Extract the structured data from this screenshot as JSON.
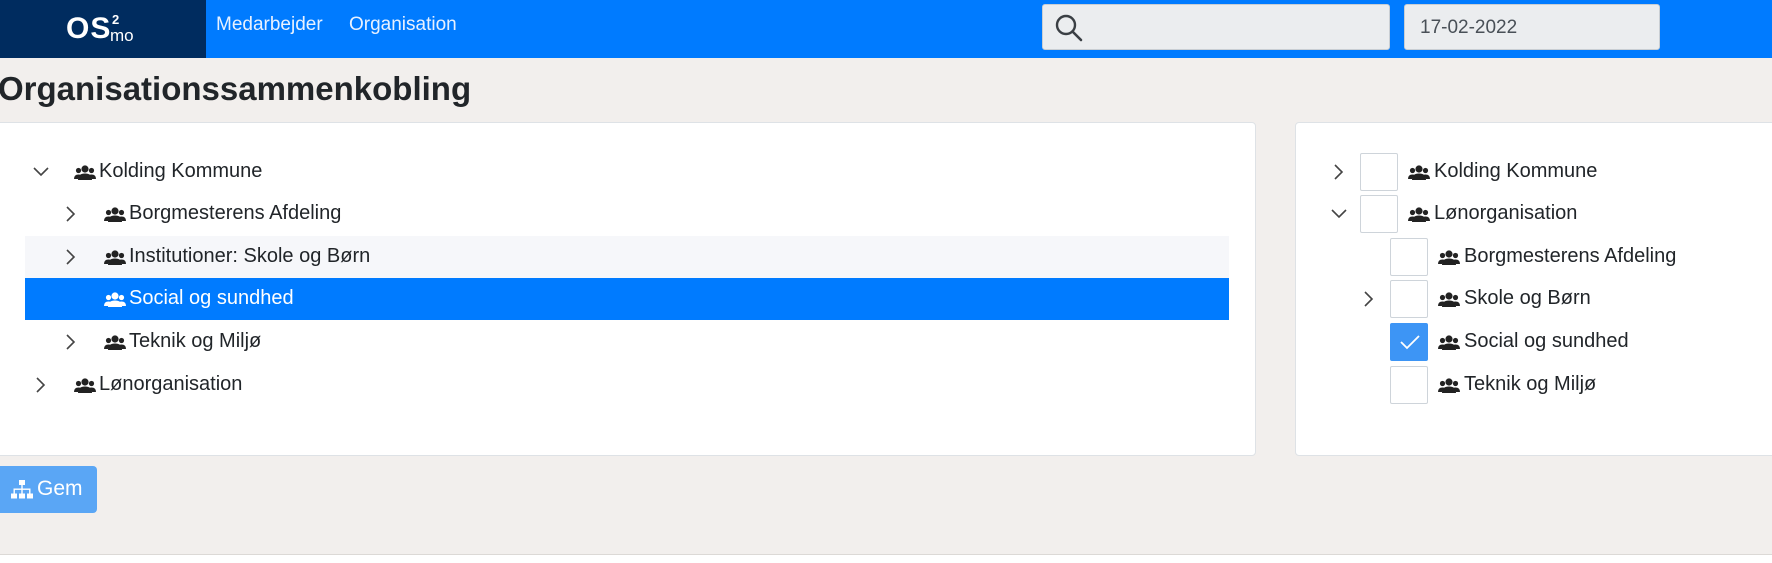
{
  "brand": {
    "logo_main": "OS",
    "logo_sup": "2",
    "logo_sub": "mo"
  },
  "nav": {
    "items": [
      {
        "label": "Medarbejder"
      },
      {
        "label": "Organisation"
      }
    ]
  },
  "search": {
    "value": "",
    "placeholder": ""
  },
  "date": {
    "value": "17-02-2022"
  },
  "page": {
    "title": "Organisationssammenkobling"
  },
  "left_tree": {
    "nodes": [
      {
        "label": "Kolding Kommune",
        "expander": "chevron-down",
        "level": 0
      },
      {
        "label": "Borgmesterens Afdeling",
        "expander": "chevron-right",
        "level": 1
      },
      {
        "label": "Institutioner: Skole og Børn",
        "expander": "chevron-right",
        "level": 1,
        "hovered": true
      },
      {
        "label": "Social og sundhed",
        "expander": "none",
        "level": 1,
        "selected": true
      },
      {
        "label": "Teknik og Miljø",
        "expander": "chevron-right",
        "level": 1
      },
      {
        "label": "Lønorganisation",
        "expander": "chevron-right",
        "level": 0
      }
    ]
  },
  "right_tree": {
    "nodes": [
      {
        "label": "Kolding Kommune",
        "expander": "chevron-right",
        "level": 0,
        "checked": false
      },
      {
        "label": "Lønorganisation",
        "expander": "chevron-down",
        "level": 0,
        "checked": false
      },
      {
        "label": "Borgmesterens Afdeling",
        "expander": "none",
        "level": 1,
        "checked": false
      },
      {
        "label": "Skole og Børn",
        "expander": "chevron-right",
        "level": 1,
        "checked": false
      },
      {
        "label": "Social og sundhed",
        "expander": "none",
        "level": 1,
        "checked": true
      },
      {
        "label": "Teknik og Miljø",
        "expander": "none",
        "level": 1,
        "checked": false
      }
    ]
  },
  "actions": {
    "save_label": "Gem",
    "save_icon": "sitemap-icon"
  },
  "colors": {
    "navbar": "#007bff",
    "brand_bg": "#002c5f",
    "page_bg": "#f2efed",
    "selected_row": "#007bff",
    "checkbox_checked": "#3d95f5",
    "save_button": "#5aa6f5"
  }
}
